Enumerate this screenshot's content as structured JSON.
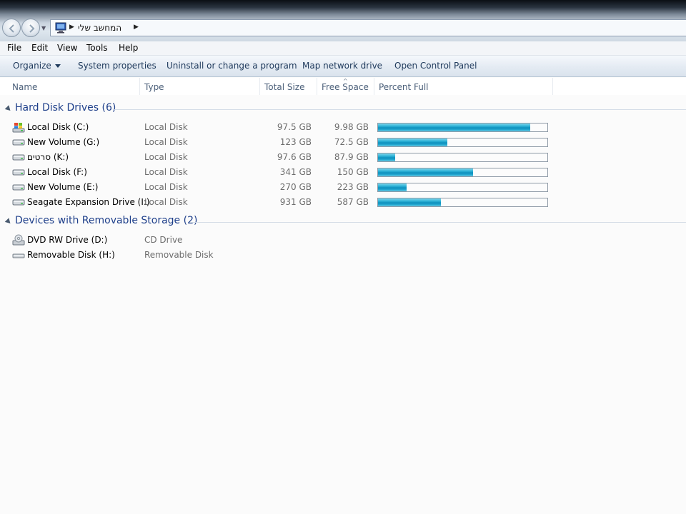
{
  "address": {
    "crumb": "המחשב שלי"
  },
  "menu": [
    "File",
    "Edit",
    "View",
    "Tools",
    "Help"
  ],
  "toolbar": {
    "organize": "Organize",
    "system_properties": "System properties",
    "uninstall": "Uninstall or change a program",
    "map_drive": "Map network drive",
    "control_panel": "Open Control Panel"
  },
  "columns": {
    "name": "Name",
    "type": "Type",
    "total": "Total Size",
    "free": "Free Space",
    "percent": "Percent Full"
  },
  "groups": {
    "hdd": {
      "title": "Hard Disk Drives (6)",
      "drives": [
        {
          "name": "Local Disk (C:)",
          "type": "Local Disk",
          "total": "97.5 GB",
          "free": "9.98 GB",
          "percent_full": 90,
          "icon": "system-drive-icon"
        },
        {
          "name": "New Volume (G:)",
          "type": "Local Disk",
          "total": "123 GB",
          "free": "72.5 GB",
          "percent_full": 41,
          "icon": "hard-drive-icon"
        },
        {
          "name": "סרטים (K:)",
          "type": "Local Disk",
          "total": "97.6 GB",
          "free": "87.9 GB",
          "percent_full": 10,
          "icon": "hard-drive-icon"
        },
        {
          "name": "Local Disk (F:)",
          "type": "Local Disk",
          "total": "341 GB",
          "free": "150 GB",
          "percent_full": 56,
          "icon": "hard-drive-icon"
        },
        {
          "name": "New Volume (E:)",
          "type": "Local Disk",
          "total": "270 GB",
          "free": "223 GB",
          "percent_full": 17,
          "icon": "hard-drive-icon"
        },
        {
          "name": "Seagate Expansion Drive (I:)",
          "type": "Local Disk",
          "total": "931 GB",
          "free": "587 GB",
          "percent_full": 37,
          "icon": "hard-drive-icon"
        }
      ]
    },
    "removable": {
      "title": "Devices with Removable Storage (2)",
      "devices": [
        {
          "name": "DVD RW Drive (D:)",
          "type": "CD Drive",
          "icon": "dvd-drive-icon"
        },
        {
          "name": "Removable Disk (H:)",
          "type": "Removable Disk",
          "icon": "removable-disk-icon"
        }
      ]
    }
  },
  "colors": {
    "group_title": "#1e3f8a",
    "bar_fill": "#0d8fbd"
  }
}
